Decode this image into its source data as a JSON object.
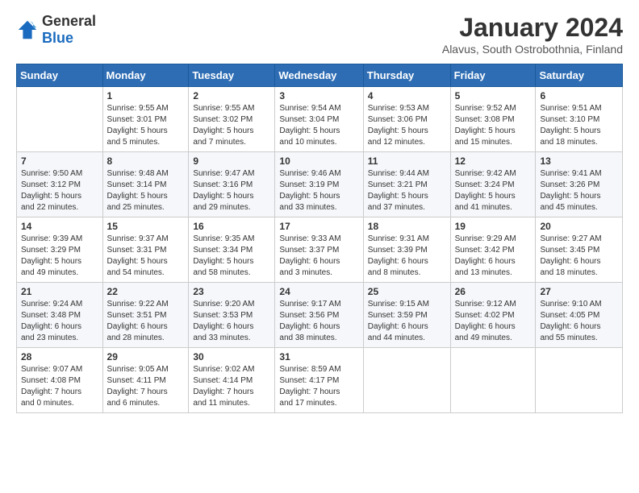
{
  "logo": {
    "general": "General",
    "blue": "Blue"
  },
  "title": "January 2024",
  "subtitle": "Alavus, South Ostrobothnia, Finland",
  "days_header": [
    "Sunday",
    "Monday",
    "Tuesday",
    "Wednesday",
    "Thursday",
    "Friday",
    "Saturday"
  ],
  "weeks": [
    [
      {
        "day": "",
        "info": ""
      },
      {
        "day": "1",
        "info": "Sunrise: 9:55 AM\nSunset: 3:01 PM\nDaylight: 5 hours\nand 5 minutes."
      },
      {
        "day": "2",
        "info": "Sunrise: 9:55 AM\nSunset: 3:02 PM\nDaylight: 5 hours\nand 7 minutes."
      },
      {
        "day": "3",
        "info": "Sunrise: 9:54 AM\nSunset: 3:04 PM\nDaylight: 5 hours\nand 10 minutes."
      },
      {
        "day": "4",
        "info": "Sunrise: 9:53 AM\nSunset: 3:06 PM\nDaylight: 5 hours\nand 12 minutes."
      },
      {
        "day": "5",
        "info": "Sunrise: 9:52 AM\nSunset: 3:08 PM\nDaylight: 5 hours\nand 15 minutes."
      },
      {
        "day": "6",
        "info": "Sunrise: 9:51 AM\nSunset: 3:10 PM\nDaylight: 5 hours\nand 18 minutes."
      }
    ],
    [
      {
        "day": "7",
        "info": "Sunrise: 9:50 AM\nSunset: 3:12 PM\nDaylight: 5 hours\nand 22 minutes."
      },
      {
        "day": "8",
        "info": "Sunrise: 9:48 AM\nSunset: 3:14 PM\nDaylight: 5 hours\nand 25 minutes."
      },
      {
        "day": "9",
        "info": "Sunrise: 9:47 AM\nSunset: 3:16 PM\nDaylight: 5 hours\nand 29 minutes."
      },
      {
        "day": "10",
        "info": "Sunrise: 9:46 AM\nSunset: 3:19 PM\nDaylight: 5 hours\nand 33 minutes."
      },
      {
        "day": "11",
        "info": "Sunrise: 9:44 AM\nSunset: 3:21 PM\nDaylight: 5 hours\nand 37 minutes."
      },
      {
        "day": "12",
        "info": "Sunrise: 9:42 AM\nSunset: 3:24 PM\nDaylight: 5 hours\nand 41 minutes."
      },
      {
        "day": "13",
        "info": "Sunrise: 9:41 AM\nSunset: 3:26 PM\nDaylight: 5 hours\nand 45 minutes."
      }
    ],
    [
      {
        "day": "14",
        "info": "Sunrise: 9:39 AM\nSunset: 3:29 PM\nDaylight: 5 hours\nand 49 minutes."
      },
      {
        "day": "15",
        "info": "Sunrise: 9:37 AM\nSunset: 3:31 PM\nDaylight: 5 hours\nand 54 minutes."
      },
      {
        "day": "16",
        "info": "Sunrise: 9:35 AM\nSunset: 3:34 PM\nDaylight: 5 hours\nand 58 minutes."
      },
      {
        "day": "17",
        "info": "Sunrise: 9:33 AM\nSunset: 3:37 PM\nDaylight: 6 hours\nand 3 minutes."
      },
      {
        "day": "18",
        "info": "Sunrise: 9:31 AM\nSunset: 3:39 PM\nDaylight: 6 hours\nand 8 minutes."
      },
      {
        "day": "19",
        "info": "Sunrise: 9:29 AM\nSunset: 3:42 PM\nDaylight: 6 hours\nand 13 minutes."
      },
      {
        "day": "20",
        "info": "Sunrise: 9:27 AM\nSunset: 3:45 PM\nDaylight: 6 hours\nand 18 minutes."
      }
    ],
    [
      {
        "day": "21",
        "info": "Sunrise: 9:24 AM\nSunset: 3:48 PM\nDaylight: 6 hours\nand 23 minutes."
      },
      {
        "day": "22",
        "info": "Sunrise: 9:22 AM\nSunset: 3:51 PM\nDaylight: 6 hours\nand 28 minutes."
      },
      {
        "day": "23",
        "info": "Sunrise: 9:20 AM\nSunset: 3:53 PM\nDaylight: 6 hours\nand 33 minutes."
      },
      {
        "day": "24",
        "info": "Sunrise: 9:17 AM\nSunset: 3:56 PM\nDaylight: 6 hours\nand 38 minutes."
      },
      {
        "day": "25",
        "info": "Sunrise: 9:15 AM\nSunset: 3:59 PM\nDaylight: 6 hours\nand 44 minutes."
      },
      {
        "day": "26",
        "info": "Sunrise: 9:12 AM\nSunset: 4:02 PM\nDaylight: 6 hours\nand 49 minutes."
      },
      {
        "day": "27",
        "info": "Sunrise: 9:10 AM\nSunset: 4:05 PM\nDaylight: 6 hours\nand 55 minutes."
      }
    ],
    [
      {
        "day": "28",
        "info": "Sunrise: 9:07 AM\nSunset: 4:08 PM\nDaylight: 7 hours\nand 0 minutes."
      },
      {
        "day": "29",
        "info": "Sunrise: 9:05 AM\nSunset: 4:11 PM\nDaylight: 7 hours\nand 6 minutes."
      },
      {
        "day": "30",
        "info": "Sunrise: 9:02 AM\nSunset: 4:14 PM\nDaylight: 7 hours\nand 11 minutes."
      },
      {
        "day": "31",
        "info": "Sunrise: 8:59 AM\nSunset: 4:17 PM\nDaylight: 7 hours\nand 17 minutes."
      },
      {
        "day": "",
        "info": ""
      },
      {
        "day": "",
        "info": ""
      },
      {
        "day": "",
        "info": ""
      }
    ]
  ]
}
